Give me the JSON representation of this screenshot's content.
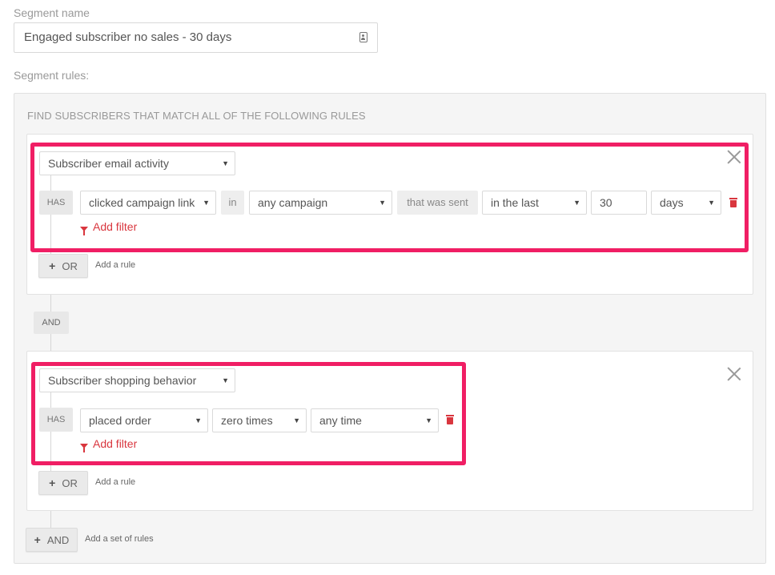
{
  "segment_name": {
    "label": "Segment name",
    "value": "Engaged subscriber no sales - 30 days"
  },
  "segment_rules": {
    "label": "Segment rules:",
    "title": "FIND SUBSCRIBERS THAT MATCH ALL OF THE FOLLOWING RULES",
    "and_connector": "AND",
    "add_and_button": "AND",
    "add_set_hint": "Add a set of rules",
    "rule_sets": [
      {
        "category": "Subscriber email activity",
        "has_label": "HAS",
        "action": "clicked campaign link",
        "in_label": "in",
        "campaign": "any campaign",
        "sent_label": "that was sent",
        "time_qualifier": "in the last",
        "amount": "30",
        "unit": "days",
        "add_filter": "Add filter",
        "or_button": "OR",
        "add_rule_hint": "Add a rule"
      },
      {
        "category": "Subscriber shopping behavior",
        "has_label": "HAS",
        "action": "placed order",
        "frequency": "zero times",
        "period": "any time",
        "add_filter": "Add filter",
        "or_button": "OR",
        "add_rule_hint": "Add a rule"
      }
    ]
  },
  "colors": {
    "highlight": "#f01e64",
    "danger": "#d9363e"
  }
}
